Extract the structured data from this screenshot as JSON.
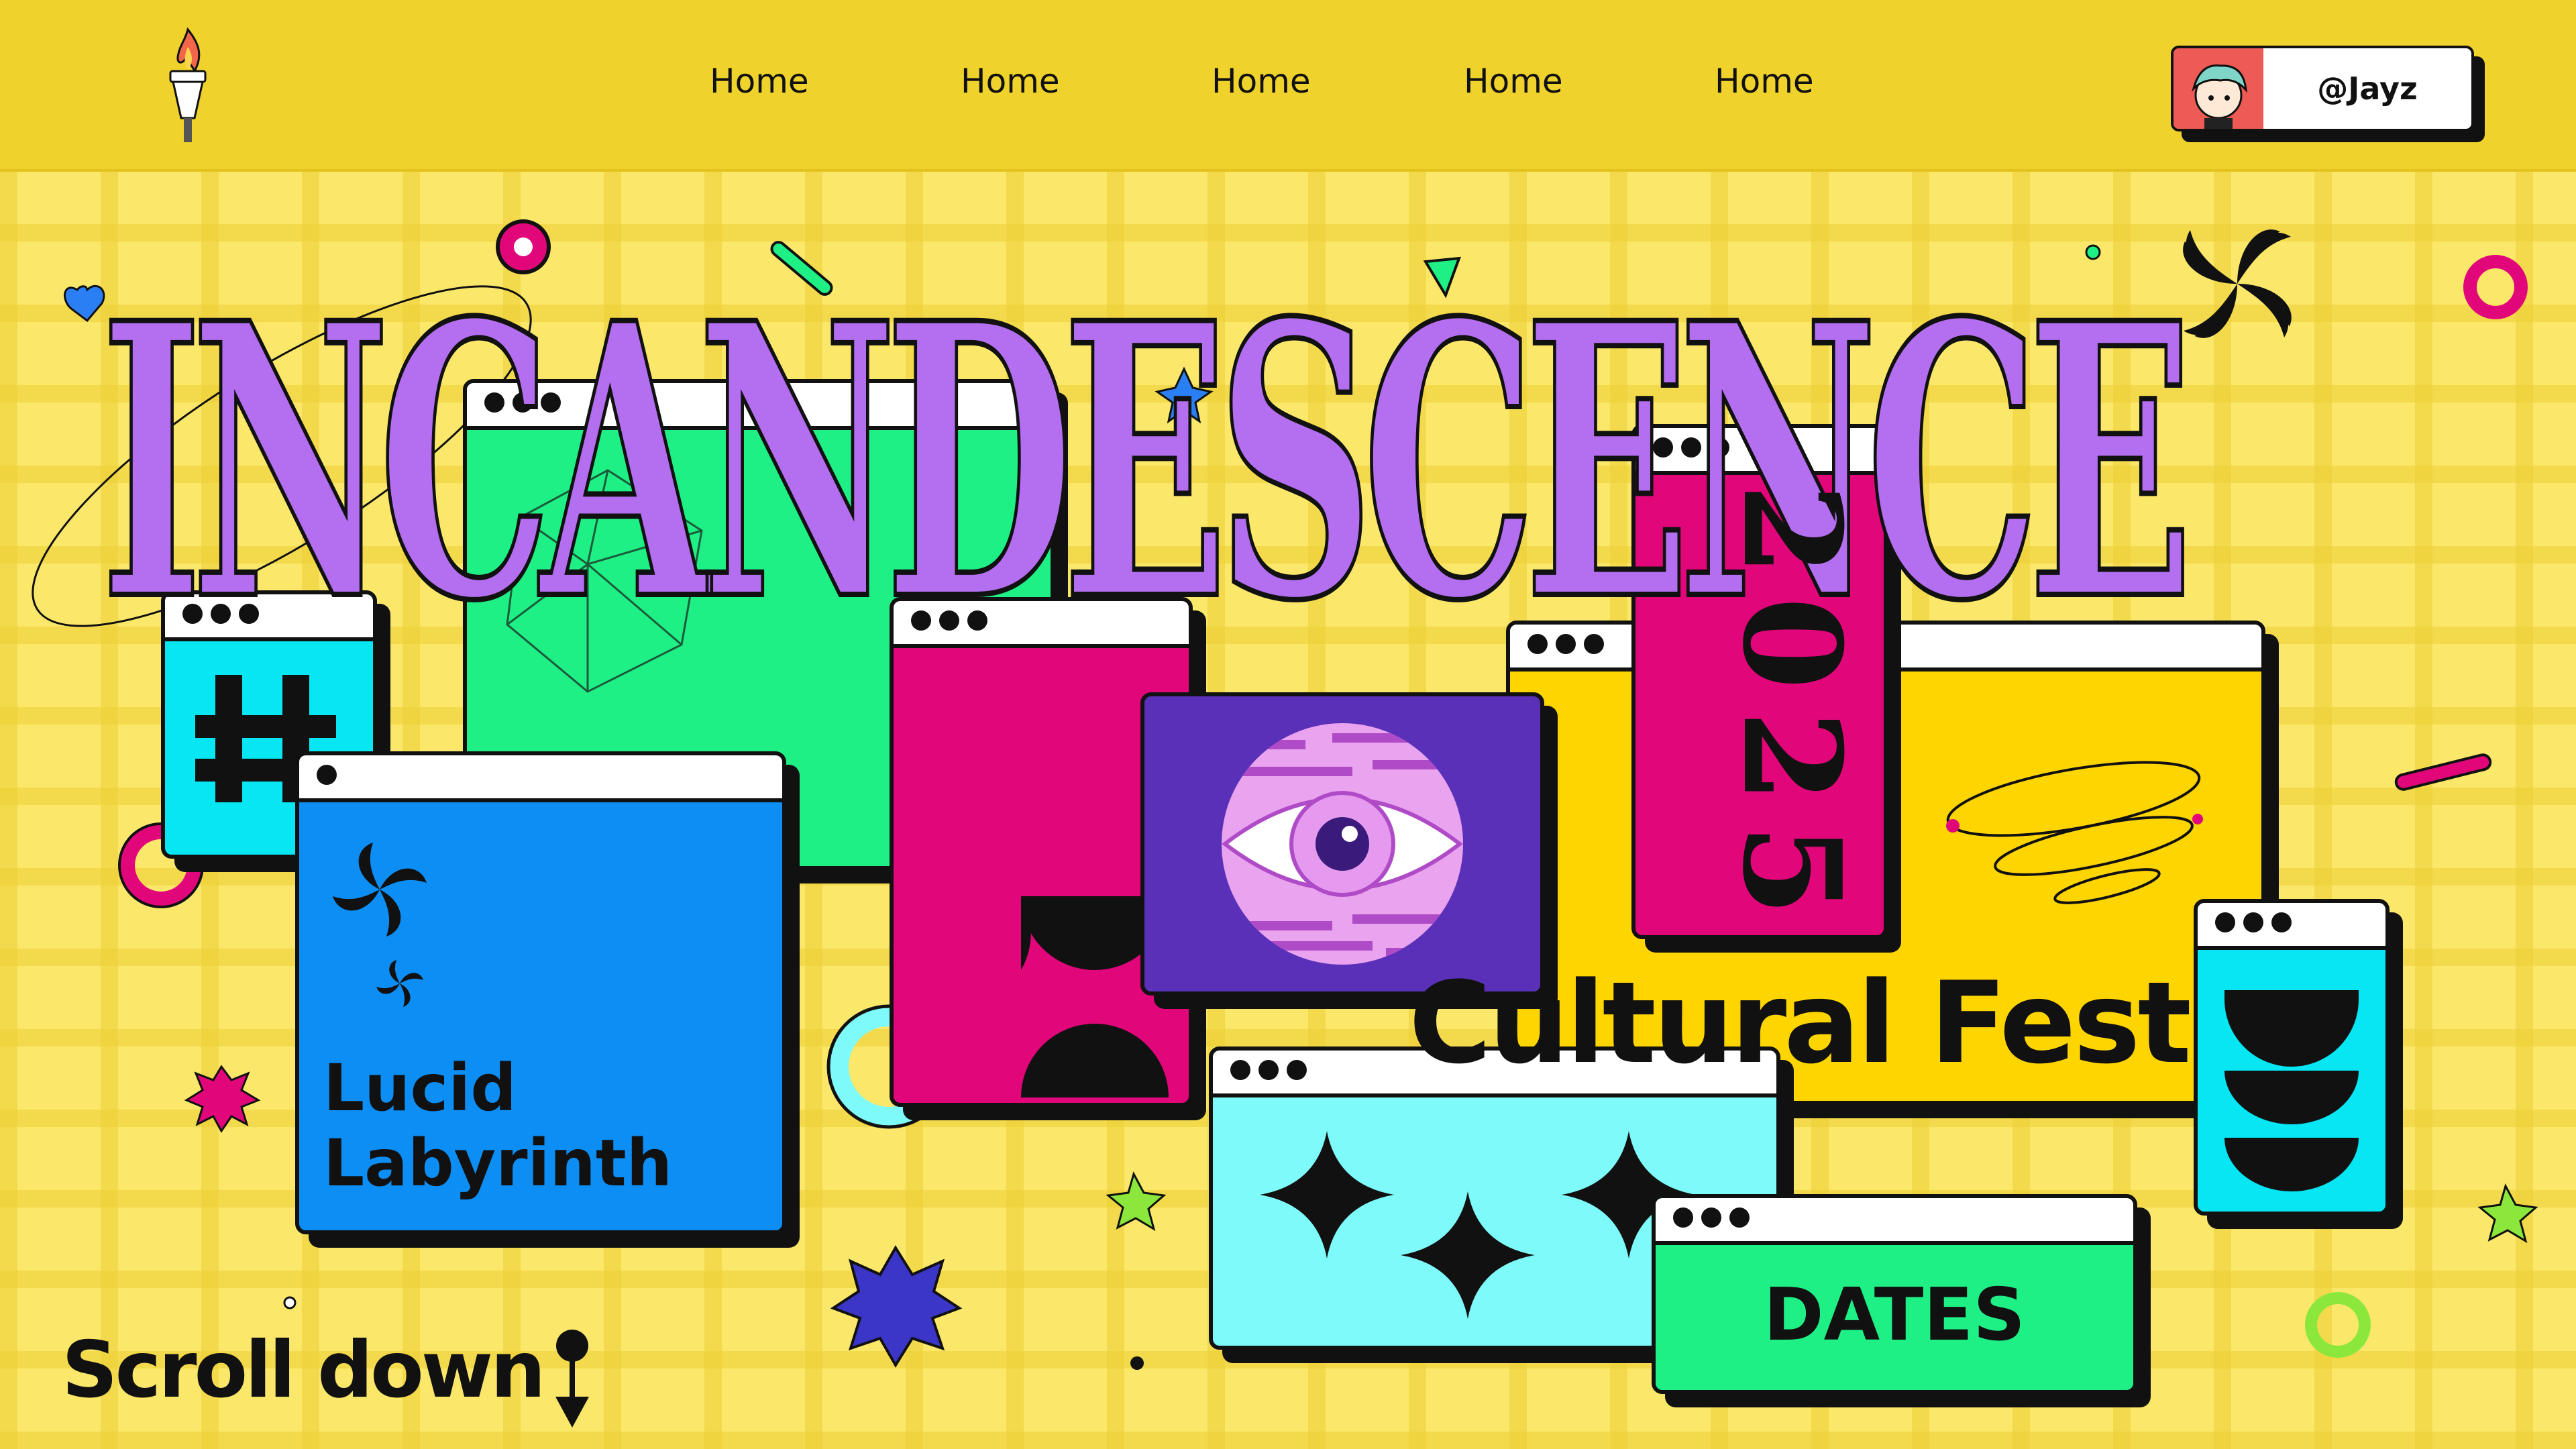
{
  "nav": {
    "logo_icon": "torch-icon",
    "items": [
      {
        "label": "Home"
      },
      {
        "label": "Home"
      },
      {
        "label": "Home"
      },
      {
        "label": "Home"
      },
      {
        "label": "Home"
      }
    ],
    "profile": {
      "handle": "@Jayz",
      "avatar_icon": "avatar-icon"
    }
  },
  "hero": {
    "title": "INCANDESCENCE",
    "subtitle": "Cultural Fest",
    "year": "2025",
    "window_label_1": "Lucid",
    "window_label_2": "Labyrinth",
    "dates_label": "DATES",
    "scroll_label": "Scroll down"
  },
  "colors": {
    "background": "#fbe86a",
    "topbar": "#f0d22c",
    "purple": "#b46ff0",
    "green": "#1ff086",
    "pink": "#e1067a",
    "blue": "#0d8ef5",
    "cyan": "#06e6f3",
    "yellow": "#ffd500",
    "violet": "#5a30b8",
    "light_cyan": "#7ffafa"
  }
}
